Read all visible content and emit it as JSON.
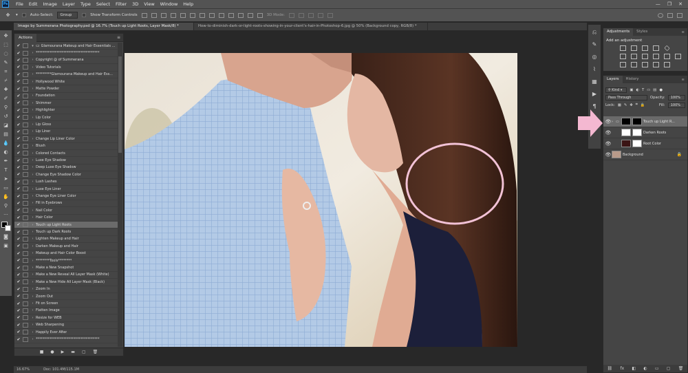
{
  "menu": [
    "File",
    "Edit",
    "Image",
    "Layer",
    "Type",
    "Select",
    "Filter",
    "3D",
    "View",
    "Window",
    "Help"
  ],
  "options": {
    "auto_select": "Auto-Select:",
    "group": "Group",
    "show_transform": "Show Transform Controls",
    "mode_3d": "3D Mode:"
  },
  "tabs": [
    "Image by Summerana Photography.psd @ 16.7% (Touch up Light Roots, Layer Mask/8) *",
    "How-to-diminish-dark-or-light-roots-showing-in-your-client's-hair-in-Photoshop-6.jpg @ 50% (Background copy, RGB/8) *"
  ],
  "actions_panel": {
    "title": "Actions",
    "rows": [
      {
        "label": "Glamourana Makeup and Hair Essentials ...",
        "check": "✔",
        "arrow": "▾"
      },
      {
        "label": "*************************************",
        "check": "✔",
        "arrow": "›"
      },
      {
        "label": "Copyright @ of Summerana",
        "check": "✔",
        "arrow": "›"
      },
      {
        "label": "Video Tutorials",
        "check": "✔",
        "arrow": "›"
      },
      {
        "label": "*********Glamourana Makeup and Hair Ess...",
        "check": "✔",
        "arrow": "›"
      },
      {
        "label": "Hollywood White",
        "check": "✔",
        "arrow": "›"
      },
      {
        "label": "Matte Powder",
        "check": "✔",
        "arrow": "›"
      },
      {
        "label": "Foundation",
        "check": "✔",
        "arrow": "›"
      },
      {
        "label": "Shimmer",
        "check": "✔",
        "arrow": "›"
      },
      {
        "label": "Highlighter",
        "check": "✔",
        "arrow": "›"
      },
      {
        "label": "Lip Color",
        "check": "✔",
        "arrow": "›"
      },
      {
        "label": "Lip Gloss",
        "check": "✔",
        "arrow": "›"
      },
      {
        "label": "Lip Liner",
        "check": "✔",
        "arrow": "›"
      },
      {
        "label": "Change Lip Liner Color",
        "check": "✔",
        "arrow": "›"
      },
      {
        "label": "Blush",
        "check": "✔",
        "arrow": "›"
      },
      {
        "label": "Colored Contacts",
        "check": "✔",
        "arrow": "›"
      },
      {
        "label": "Luxe Eye Shadow",
        "check": "✔",
        "arrow": "›"
      },
      {
        "label": "Deep Luxe Eye Shadow",
        "check": "✔",
        "arrow": "›"
      },
      {
        "label": "Change Eye Shadow Color",
        "check": "✔",
        "arrow": "›"
      },
      {
        "label": "Lush Lashes",
        "check": "✔",
        "arrow": "›"
      },
      {
        "label": "Luxe Eye Liner",
        "check": "✔",
        "arrow": "›"
      },
      {
        "label": "Change Eye Liner Color",
        "check": "✔",
        "arrow": "›"
      },
      {
        "label": "Fill in Eyebrows",
        "check": "✔",
        "arrow": "›"
      },
      {
        "label": "Nail Color",
        "check": "✔",
        "arrow": "›"
      },
      {
        "label": "Hair Color",
        "check": "✔",
        "arrow": "›"
      },
      {
        "label": "Touch up Light Roots",
        "check": "✔",
        "arrow": "›",
        "selected": true
      },
      {
        "label": "Touch up Dark Roots",
        "check": "✔",
        "arrow": "›"
      },
      {
        "label": "Lighten Makeup and Hair",
        "check": "✔",
        "arrow": "›"
      },
      {
        "label": "Darken Makeup and Hair",
        "check": "✔",
        "arrow": "›"
      },
      {
        "label": "Makeup and Hair Color Boost",
        "check": "✔",
        "arrow": "›"
      },
      {
        "label": "********Tools********",
        "check": "✔",
        "arrow": "›"
      },
      {
        "label": "Make a New Snapshot",
        "check": "✔",
        "arrow": "›"
      },
      {
        "label": "Make a New Reveal All Layer Mask (White)",
        "check": "✔",
        "arrow": "›"
      },
      {
        "label": "Make a New Hide All Layer Mask (Black)",
        "check": "✔",
        "arrow": "›"
      },
      {
        "label": "Zoom In",
        "check": "✔",
        "arrow": "›"
      },
      {
        "label": "Zoom Out",
        "check": "✔",
        "arrow": "›"
      },
      {
        "label": "Fit on Screen",
        "check": "✔",
        "arrow": "›"
      },
      {
        "label": "Flatten Image",
        "check": "✔",
        "arrow": "›"
      },
      {
        "label": "Resize for WEB",
        "check": "✔",
        "arrow": "›"
      },
      {
        "label": "Web Sharpening",
        "check": "✔",
        "arrow": "›"
      },
      {
        "label": "Happily Ever After",
        "check": "✔",
        "arrow": "›"
      },
      {
        "label": "*************************************",
        "check": "✔",
        "arrow": "›"
      }
    ],
    "footer_icons": [
      "■",
      "●",
      "▶",
      "▬",
      "▢",
      "🗑"
    ]
  },
  "status": {
    "zoom": "16.67%",
    "doc": "Doc: 101.4M/115.1M"
  },
  "adjustments": {
    "tabs": [
      "Adjustments",
      "Styles"
    ],
    "title": "Add an adjustment"
  },
  "layers_panel": {
    "tabs": [
      "Layers",
      "History"
    ],
    "kind": "Kind",
    "blend_mode": "Pass Through",
    "opacity_label": "Opacity:",
    "opacity_value": "100%",
    "lock_label": "Lock:",
    "fill_label": "Fill:",
    "fill_value": "100%",
    "layers": [
      {
        "name": "Touch up Light R...",
        "selected": true,
        "thumb": "#000000",
        "thumb2": "#000000"
      },
      {
        "name": "Darken Roots",
        "thumb": "#ffffff",
        "thumb2": "#ffffff"
      },
      {
        "name": "Root Color",
        "thumb": "#3b1414",
        "thumb2": "#ffffff"
      },
      {
        "name": "Background",
        "thumb": "#b89a8a"
      }
    ],
    "footer_icons": [
      "⛓",
      "fx",
      "◧",
      "◐",
      "▭",
      "▢",
      "🗑"
    ]
  },
  "colors": {
    "annotation_pink": "#f4b8d1",
    "circle_stroke": "#f2c2d6"
  }
}
